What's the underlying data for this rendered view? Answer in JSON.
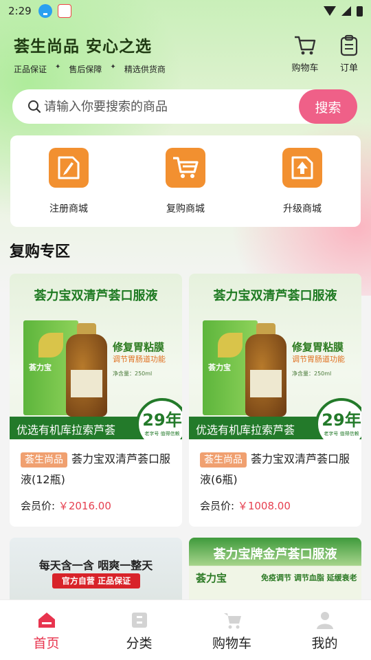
{
  "status_bar": {
    "time": "2:29"
  },
  "header": {
    "title": "荟生尚品  安心之选",
    "tags": [
      "正品保证",
      "售后保障",
      "精选供货商"
    ],
    "cart_label": "购物车",
    "orders_label": "订单"
  },
  "search": {
    "placeholder": "请输入你要搜索的商品",
    "button_label": "搜索"
  },
  "quick_entries": [
    {
      "label": "注册商城",
      "icon": "edit-document-icon"
    },
    {
      "label": "复购商城",
      "icon": "shopping-cart-icon"
    },
    {
      "label": "升级商城",
      "icon": "upgrade-document-icon"
    }
  ],
  "section": {
    "title": "复购专区"
  },
  "products": [
    {
      "image_headline": "荟力宝双清芦荟口服液",
      "image_claim": "修复胃粘膜",
      "image_subclaim": "调节胃肠道功能",
      "image_net": "净含量：250ml",
      "image_ribbon": "优选有机库拉索芦荟",
      "image_badge_year": "29年",
      "image_badge_sub": "老字号 值得信赖",
      "image_box_brand": "荟力宝",
      "tag": "荟生尚品",
      "name": "荟力宝双清芦荟口服液(12瓶)",
      "member_label": "会员价:",
      "price": "￥2016.00"
    },
    {
      "image_headline": "荟力宝双清芦荟口服液",
      "image_claim": "修复胃粘膜",
      "image_subclaim": "调节胃肠道功能",
      "image_net": "净含量：250ml",
      "image_ribbon": "优选有机库拉索芦荟",
      "image_badge_year": "29年",
      "image_badge_sub": "老字号 值得信赖",
      "image_box_brand": "荟力宝",
      "tag": "荟生尚品",
      "name": "荟力宝双清芦荟口服液(6瓶)",
      "member_label": "会员价:",
      "price": "￥1008.00"
    }
  ],
  "promos": [
    {
      "headline": "每天含一含 咽爽一整天",
      "pill": "官方自营 正品保证"
    },
    {
      "headline": "荟力宝牌金芦荟口服液",
      "brand": "荟力宝",
      "sub": "免疫调节 调节血脂 延缓衰老"
    }
  ],
  "tabbar": [
    {
      "label": "首页",
      "active": true
    },
    {
      "label": "分类",
      "active": false
    },
    {
      "label": "购物车",
      "active": false
    },
    {
      "label": "我的",
      "active": false
    }
  ],
  "colors": {
    "accent": "#e8344e",
    "search_button": "#ef6088",
    "icon_orange": "#f29030",
    "price": "#e64050",
    "brand_green": "#237a2a"
  }
}
